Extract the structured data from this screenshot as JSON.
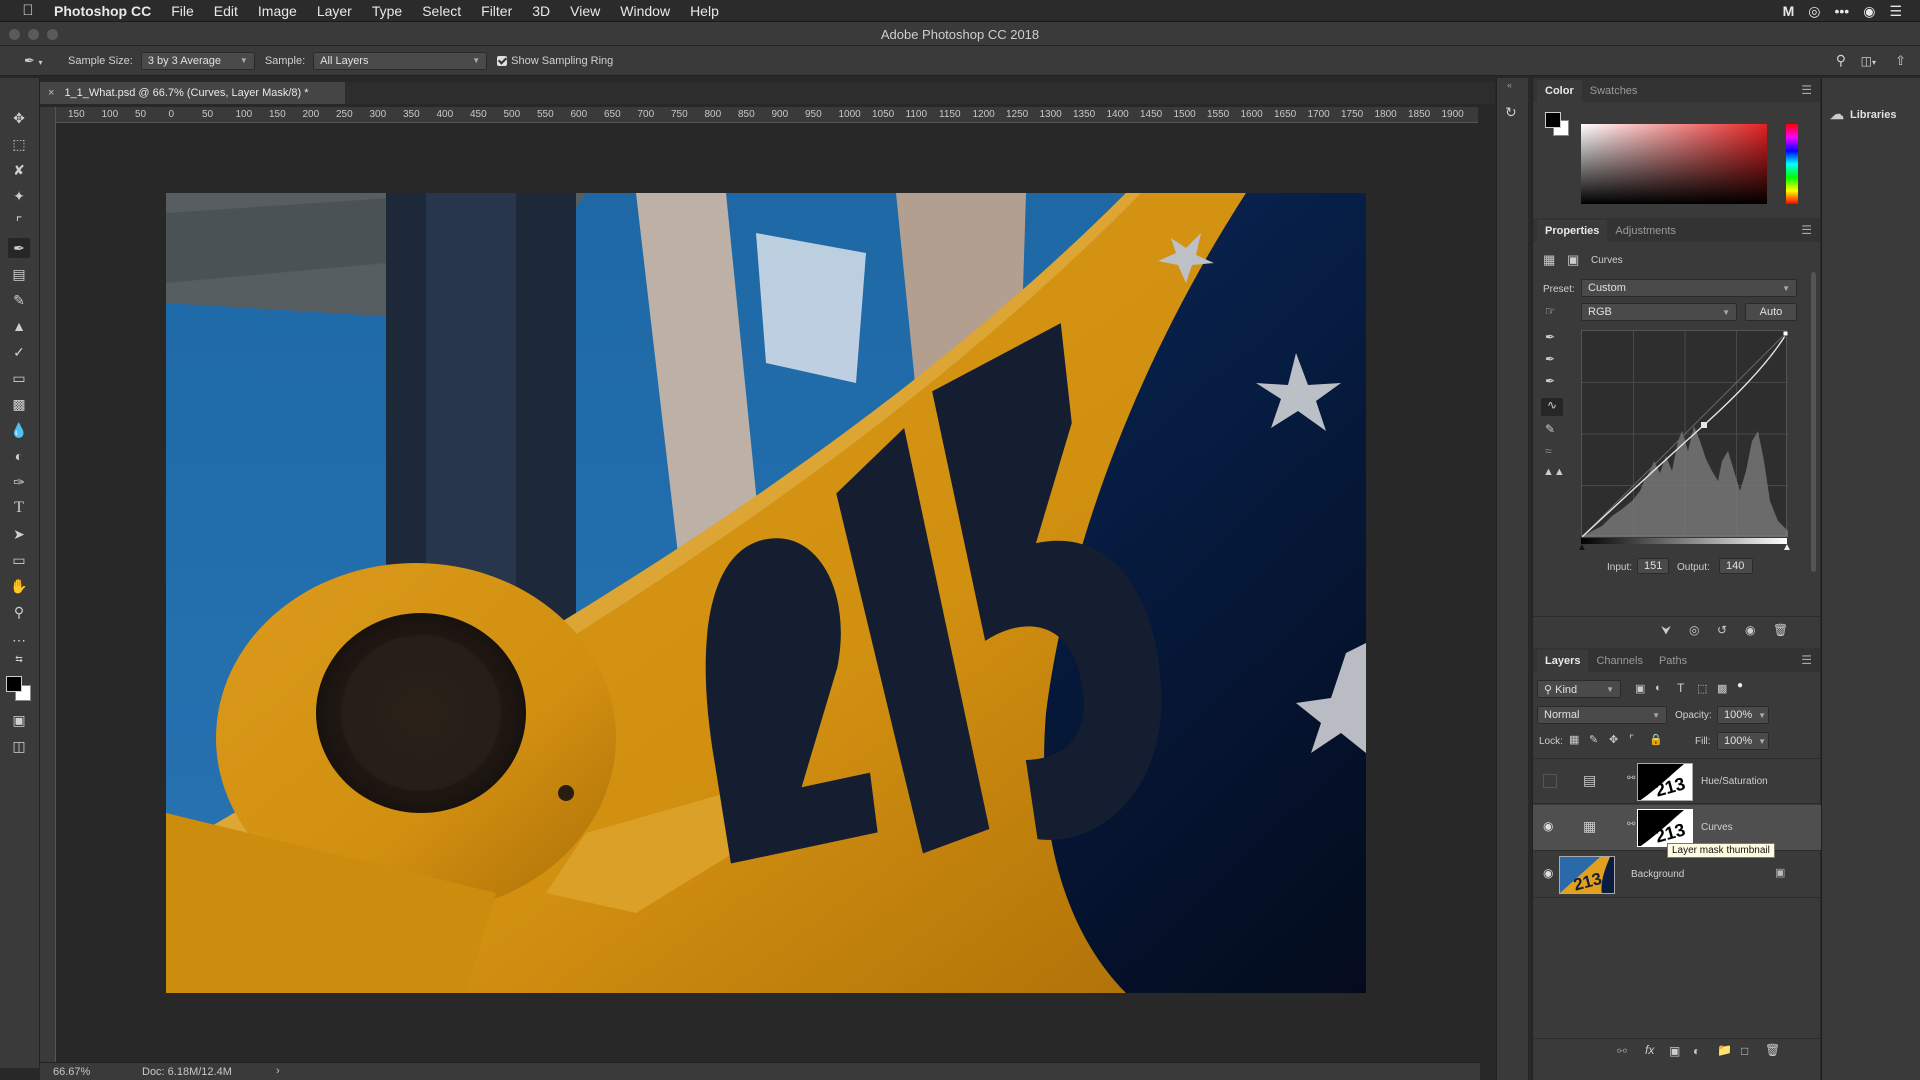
{
  "menubar": {
    "app_name": "Photoshop CC",
    "items": [
      "File",
      "Edit",
      "Image",
      "Layer",
      "Type",
      "Select",
      "Filter",
      "3D",
      "View",
      "Window",
      "Help"
    ]
  },
  "titlebar": {
    "title": "Adobe Photoshop CC 2018"
  },
  "options": {
    "sample_size_label": "Sample Size:",
    "sample_size_value": "3 by 3 Average",
    "sample_label": "Sample:",
    "sample_value": "All Layers",
    "sampling_ring_label": "Show Sampling Ring",
    "sampling_ring_checked": true
  },
  "document": {
    "tab_title": "1_1_What.psd @ 66.7% (Curves, Layer Mask/8) *",
    "ruler_ticks": [
      "150",
      "100",
      "50",
      "0",
      "50",
      "100",
      "150",
      "200",
      "250",
      "300",
      "350",
      "400",
      "450",
      "500",
      "550",
      "600",
      "650",
      "700",
      "750",
      "800",
      "850",
      "900",
      "950",
      "1000",
      "1050",
      "1100",
      "1150",
      "1200",
      "1250",
      "1300",
      "1350",
      "1400",
      "1450",
      "1500",
      "1550",
      "1600",
      "1650",
      "1700",
      "1750",
      "1800",
      "1850",
      "1900"
    ],
    "photo_number": "213"
  },
  "status": {
    "zoom": "66.67%",
    "doc": "Doc: 6.18M/12.4M"
  },
  "color_panel": {
    "tabs": [
      "Color",
      "Swatches"
    ],
    "active": "Color"
  },
  "properties_panel": {
    "tabs": [
      "Properties",
      "Adjustments"
    ],
    "active": "Properties",
    "adjustment_name": "Curves",
    "preset_label": "Preset:",
    "preset_value": "Custom",
    "channel_value": "RGB",
    "auto_label": "Auto",
    "input_label": "Input:",
    "input_value": "151",
    "output_label": "Output:",
    "output_value": "140"
  },
  "layers_panel": {
    "tabs": [
      "Layers",
      "Channels",
      "Paths"
    ],
    "active": "Layers",
    "filter_kind": "Kind",
    "blend_mode": "Normal",
    "opacity_label": "Opacity:",
    "opacity_value": "100%",
    "lock_label": "Lock:",
    "fill_label": "Fill:",
    "fill_value": "100%",
    "layers": [
      {
        "name": "Hue/Saturation",
        "visible": false,
        "selected": false
      },
      {
        "name": "Curves",
        "visible": true,
        "selected": true
      },
      {
        "name": "Background",
        "visible": true,
        "selected": false
      }
    ],
    "tooltip": "Layer mask thumbnail"
  },
  "libraries": {
    "label": "Libraries"
  },
  "colors": {
    "accent_red": "#e02020",
    "panel_bg": "#3a3a3a",
    "canvas_bg": "#282828"
  }
}
